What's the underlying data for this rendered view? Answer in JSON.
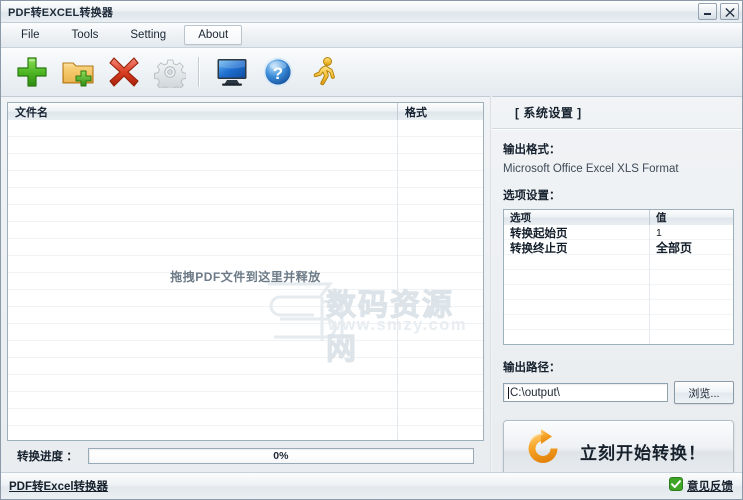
{
  "window": {
    "title": "PDF转EXCEL转换器",
    "minimize_label": "minimize",
    "close_label": "close"
  },
  "menu": {
    "items": [
      {
        "label": "File",
        "active": false
      },
      {
        "label": "Tools",
        "active": false
      },
      {
        "label": "Setting",
        "active": false
      },
      {
        "label": "About",
        "active": true
      }
    ]
  },
  "toolbar": {
    "buttons": [
      {
        "name": "add-file-button",
        "icon": "green-plus-icon",
        "enabled": true
      },
      {
        "name": "add-folder-button",
        "icon": "folder-add-icon",
        "enabled": true
      },
      {
        "name": "remove-file-button",
        "icon": "red-x-icon",
        "enabled": true
      },
      {
        "name": "settings-button",
        "icon": "gear-icon",
        "enabled": false
      },
      {
        "name": "monitor-button",
        "icon": "monitor-icon",
        "enabled": true
      },
      {
        "name": "help-button",
        "icon": "question-mark-icon",
        "enabled": true
      },
      {
        "name": "run-button",
        "icon": "running-person-icon",
        "enabled": true
      }
    ]
  },
  "filelist": {
    "columns": [
      "文件名",
      "格式"
    ],
    "rows": [],
    "drop_hint": "拖拽PDF文件到这里并释放"
  },
  "watermark": {
    "logo": "Sn",
    "text": "数码资源网",
    "url": "www.smzy.com"
  },
  "progress": {
    "label": "转换进度 ：",
    "percent_text": "0%",
    "percent": 0
  },
  "settings": {
    "panel_title": "[ 系统设置 ]",
    "output_format_label": "输出格式：",
    "output_format_value": "Microsoft Office Excel XLS Format",
    "options_label": "选项设置：",
    "options_table": {
      "columns": [
        "选项",
        "值"
      ],
      "rows": [
        {
          "option": "转换起始页",
          "value": "1"
        },
        {
          "option": "转换终止页",
          "value": "全部页"
        }
      ]
    },
    "output_path_label": "输出路径：",
    "output_path_value": "C:\\output\\",
    "output_path_placeholder": "C:\\output\\",
    "browse_label": "浏览...",
    "convert_label": "立刻开始转换！",
    "convert_icon": "orange-refresh-icon"
  },
  "statusbar": {
    "link_label": "PDF转Excel转换器",
    "feedback_label": "意见反馈",
    "feedback_icon": "green-check-icon"
  },
  "colors": {
    "accent_green": "#3fa527",
    "accent_red": "#d73b23",
    "accent_orange": "#f5a623",
    "accent_blue": "#2b72c8",
    "panel_bg": "#eef2f5",
    "border": "#9fb0bd"
  }
}
